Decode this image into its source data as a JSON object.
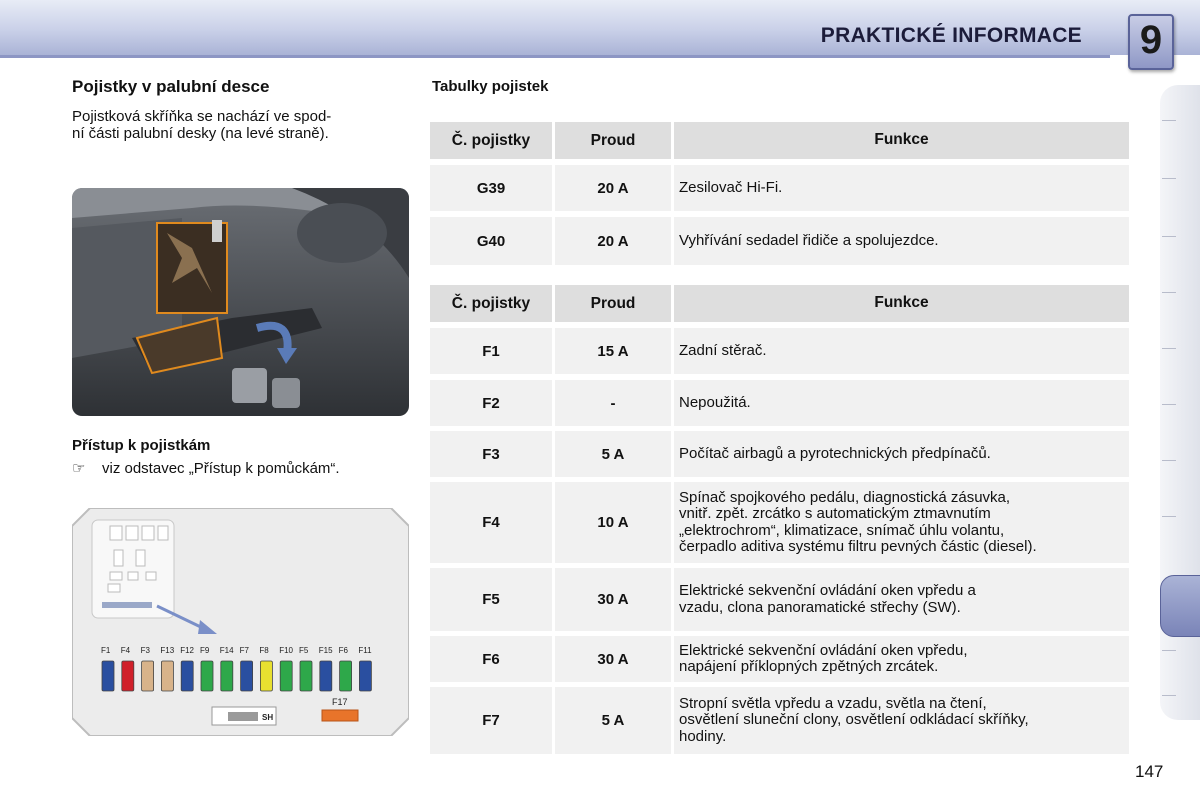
{
  "header": {
    "title": "PRAKTICKÉ INFORMACE",
    "chapter": "9"
  },
  "left": {
    "heading": "Pojistky v palubní desce",
    "intro_line1": "Pojistková skříňka se nachází ve spod-",
    "intro_line2": "ní části palubní desky (na levé straně).",
    "access_heading": "Přístup k pojistkám",
    "access_ref": "viz odstavec „Přístup k pomůckám“.",
    "hand_icon": "☞",
    "fuse_labels": [
      "F1",
      "F4",
      "F3",
      "F13",
      "F12",
      "F9",
      "F14",
      "F7",
      "F8",
      "F10",
      "F5",
      "F15",
      "F6",
      "F11"
    ],
    "fuse_colors": [
      "#2a4fa0",
      "#d0202a",
      "#d8b38a",
      "#d8b38a",
      "#2a4fa0",
      "#2ea84a",
      "#2ea84a",
      "#2a4fa0",
      "#e8e030",
      "#2ea84a",
      "#2ea84a",
      "#2a4fa0",
      "#2ea84a",
      "#2a4fa0"
    ],
    "sh_label": "SH",
    "f17_label": "F17"
  },
  "tables_title": "Tabulky pojistek",
  "table1": {
    "headers": [
      "Č. pojistky",
      "Proud",
      "Funkce"
    ],
    "rows": [
      {
        "id": "G39",
        "current": "20 A",
        "func": [
          "Zesilovač Hi-Fi."
        ]
      },
      {
        "id": "G40",
        "current": "20 A",
        "func": [
          "Vyhřívání sedadel řidiče a spolujezdce."
        ]
      }
    ]
  },
  "table2": {
    "headers": [
      "Č. pojistky",
      "Proud",
      "Funkce"
    ],
    "rows": [
      {
        "id": "F1",
        "current": "15 A",
        "func": [
          "Zadní stěrač."
        ]
      },
      {
        "id": "F2",
        "current": "-",
        "func": [
          "Nepoužitá."
        ]
      },
      {
        "id": "F3",
        "current": "5 A",
        "func": [
          "Počítač airbagů a pyrotechnických předpínačů."
        ]
      },
      {
        "id": "F4",
        "current": "10 A",
        "func": [
          "Spínač spojkového pedálu, diagnostická zásuvka,",
          "vnitř. zpět. zrcátko s automatickým ztmavnutím",
          "„elektrochrom“, klimatizace, snímač úhlu volantu,",
          "čerpadlo aditiva systému filtru pevných částic (diesel)."
        ]
      },
      {
        "id": "F5",
        "current": "30 A",
        "func": [
          "Elektrické sekvenční ovládání oken vpředu a",
          "vzadu, clona panoramatické střechy (SW)."
        ]
      },
      {
        "id": "F6",
        "current": "30 A",
        "func": [
          "Elektrické sekvenční ovládání oken vpředu,",
          "napájení příklopných zpětných zrcátek."
        ]
      },
      {
        "id": "F7",
        "current": "5 A",
        "func": [
          "Stropní světla vpředu a vzadu, světla na čtení,",
          "osvětlení sluneční clony, osvětlení odkládací skříňky,",
          "hodiny."
        ]
      }
    ]
  },
  "page_number": "147"
}
